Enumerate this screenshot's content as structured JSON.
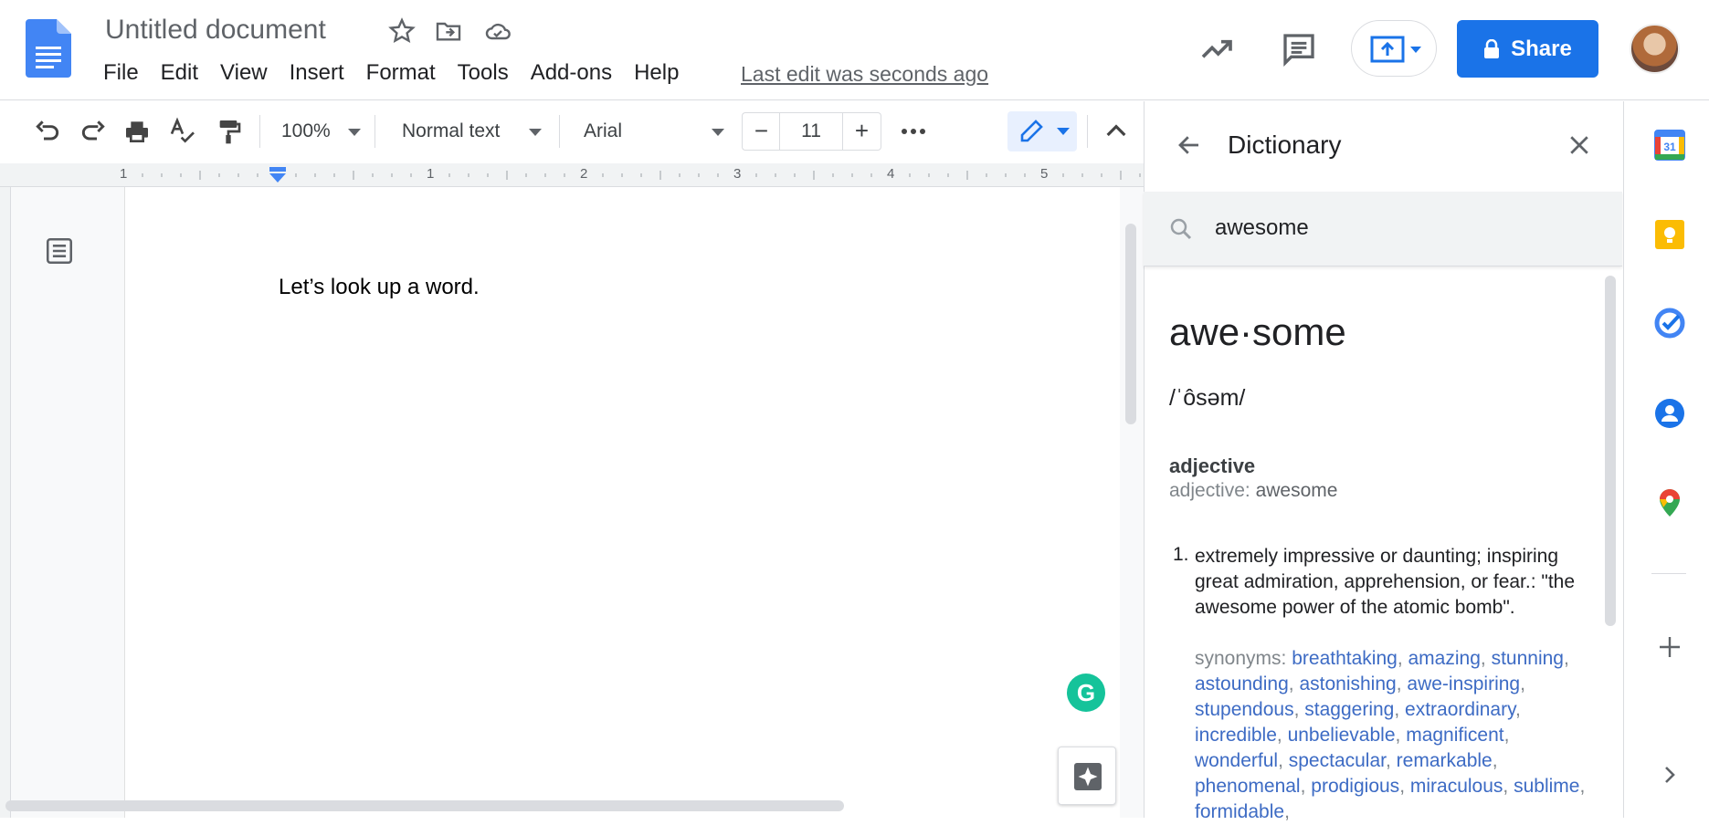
{
  "header": {
    "title": "Untitled document",
    "menu": [
      "File",
      "Edit",
      "View",
      "Insert",
      "Format",
      "Tools",
      "Add-ons",
      "Help"
    ],
    "last_edit": "Last edit was seconds ago",
    "share_label": "Share"
  },
  "toolbar": {
    "zoom": "100%",
    "style": "Normal text",
    "font": "Arial",
    "font_size": "11",
    "minus": "−",
    "plus": "+"
  },
  "ruler": {
    "numbers": [
      "1",
      "1",
      "2",
      "3",
      "4",
      "5"
    ]
  },
  "document": {
    "text": "Let’s look up a word."
  },
  "dictionary": {
    "title": "Dictionary",
    "search_value": "awesome",
    "word": "awe·some",
    "phonetic": "/ˈôsəm/",
    "pos": "adjective",
    "pos_label": "adjective:",
    "pos_value": "awesome",
    "def_number": "1.",
    "definition": "extremely impressive or daunting; inspiring great admiration, apprehension, or fear.: \"the awesome power of the atomic bomb\".",
    "synonyms_label": "synonyms:",
    "synonyms": [
      "breathtaking",
      "amazing",
      "stunning",
      "astounding",
      "astonishing",
      "awe-inspiring",
      "stupendous",
      "staggering",
      "extraordinary",
      "incredible",
      "unbelievable",
      "magnificent",
      "wonderful",
      "spectacular",
      "remarkable",
      "phenomenal",
      "prodigious",
      "miraculous",
      "sublime",
      "formidable"
    ]
  },
  "siderail": {
    "calendar_day": "31"
  },
  "grammarly": "G",
  "colors": {
    "accent": "#1a73e8",
    "link": "#3d6bc4",
    "grammarly": "#15c39a"
  },
  "icons": [
    "docs-logo-icon",
    "star-icon",
    "move-folder-icon",
    "cloud-saved-icon",
    "activity-trend-icon",
    "comment-icon",
    "present-icon",
    "lock-icon",
    "undo-icon",
    "redo-icon",
    "print-icon",
    "spellcheck-icon",
    "paint-format-icon",
    "more-icon",
    "pencil-icon",
    "collapse-icon",
    "outline-icon",
    "back-arrow-icon",
    "close-icon",
    "search-icon",
    "calendar-icon",
    "keep-icon",
    "tasks-icon",
    "contacts-icon",
    "maps-icon",
    "add-icon",
    "chevron-right-icon"
  ]
}
